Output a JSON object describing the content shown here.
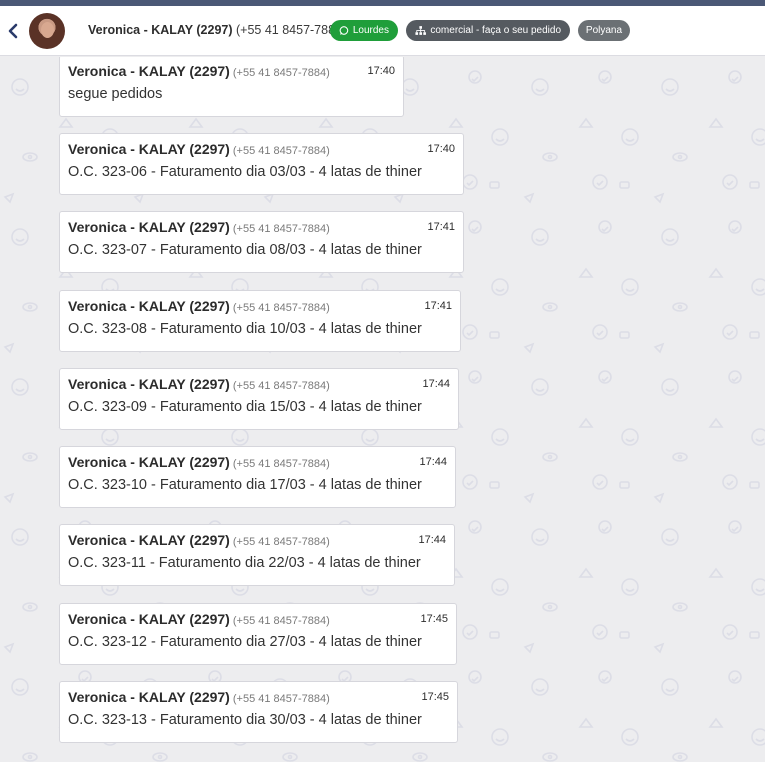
{
  "header": {
    "contact_name": "Veronica - KALAY (2297)",
    "contact_phone": "(+55 41 8457-7884)",
    "tags": [
      {
        "label": "Lourdes",
        "color": "#1f9e3a",
        "icon": "whatsapp-icon"
      },
      {
        "label": "comercial - faça o seu pedido",
        "color": "#555a60",
        "icon": "sitemap-icon"
      },
      {
        "label": "Polyana",
        "color": "#6b7074"
      }
    ]
  },
  "messages": [
    {
      "sender": "Veronica - KALAY (2297)",
      "phone": "(+55 41 8457-7884)",
      "time": "17:40",
      "text": "segue pedidos"
    },
    {
      "sender": "Veronica - KALAY (2297)",
      "phone": "(+55 41 8457-7884)",
      "time": "17:40",
      "text": "O.C. 323-06 - Faturamento dia 03/03 - 4 latas de thiner"
    },
    {
      "sender": "Veronica - KALAY (2297)",
      "phone": "(+55 41 8457-7884)",
      "time": "17:41",
      "text": "O.C. 323-07 - Faturamento dia 08/03 - 4 latas de thiner"
    },
    {
      "sender": "Veronica - KALAY (2297)",
      "phone": "(+55 41 8457-7884)",
      "time": "17:41",
      "text": "O.C. 323-08 - Faturamento dia 10/03 - 4 latas de thiner"
    },
    {
      "sender": "Veronica - KALAY (2297)",
      "phone": "(+55 41 8457-7884)",
      "time": "17:44",
      "text": "O.C. 323-09 - Faturamento dia 15/03 - 4 latas de thiner"
    },
    {
      "sender": "Veronica - KALAY (2297)",
      "phone": "(+55 41 8457-7884)",
      "time": "17:44",
      "text": "O.C. 323-10 - Faturamento dia 17/03 - 4 latas de thiner"
    },
    {
      "sender": "Veronica - KALAY (2297)",
      "phone": "(+55 41 8457-7884)",
      "time": "17:44",
      "text": "O.C. 323-11 - Faturamento dia 22/03 - 4 latas de thiner"
    },
    {
      "sender": "Veronica - KALAY (2297)",
      "phone": "(+55 41 8457-7884)",
      "time": "17:45",
      "text": "O.C. 323-12 - Faturamento dia 27/03 - 4 latas de thiner"
    },
    {
      "sender": "Veronica - KALAY (2297)",
      "phone": "(+55 41 8457-7884)",
      "time": "17:45",
      "text": "O.C. 323-13 - Faturamento dia 30/03 - 4 latas de thiner"
    }
  ]
}
